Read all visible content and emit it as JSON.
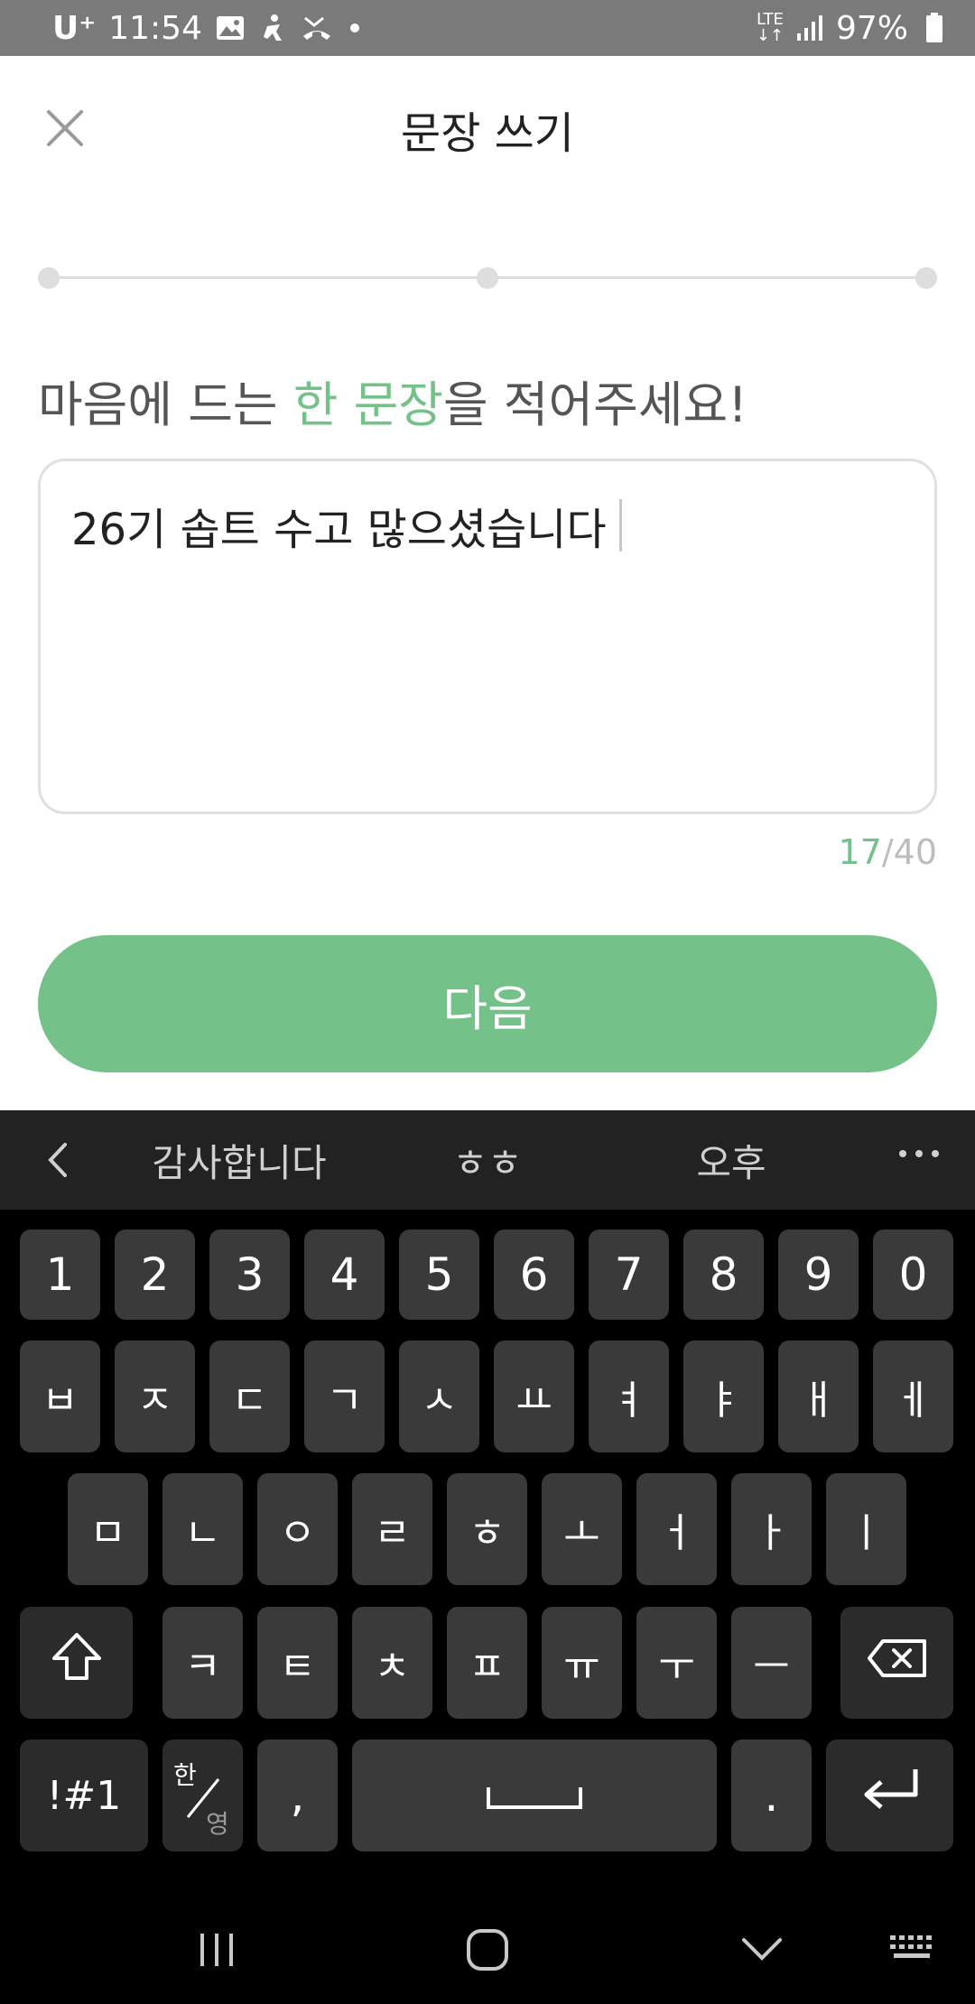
{
  "status_bar": {
    "carrier": "U⁺",
    "time": "11:54",
    "network": "LTE",
    "battery": "97%",
    "icons": [
      "image-icon",
      "accessibility-icon",
      "missed-call-icon",
      "dot-icon",
      "signal-icon",
      "battery-icon"
    ]
  },
  "header": {
    "title": "문장 쓰기",
    "close_icon": "close-icon"
  },
  "steps": {
    "count": 3,
    "current": 1
  },
  "prompt": {
    "before": "마음에 드는 ",
    "highlight": "한 문장",
    "after": "을 적어주세요!"
  },
  "input": {
    "value": "26기 솝트 수고 많으셨습니다",
    "count": "17",
    "max": "/40"
  },
  "next_button": {
    "label": "다음"
  },
  "keyboard": {
    "suggestions": [
      "감사합니다",
      "ㅎㅎ",
      "오후"
    ],
    "number_row": [
      "1",
      "2",
      "3",
      "4",
      "5",
      "6",
      "7",
      "8",
      "9",
      "0"
    ],
    "row1": [
      "ㅂ",
      "ㅈ",
      "ㄷ",
      "ㄱ",
      "ㅅ",
      "ㅛ",
      "ㅕ",
      "ㅑ",
      "ㅐ",
      "ㅔ"
    ],
    "row2": [
      "ㅁ",
      "ㄴ",
      "ㅇ",
      "ㄹ",
      "ㅎ",
      "ㅗ",
      "ㅓ",
      "ㅏ",
      "ㅣ"
    ],
    "row3": [
      "ㅋ",
      "ㅌ",
      "ㅊ",
      "ㅍ",
      "ㅠ",
      "ㅜ",
      "ㅡ"
    ],
    "symbols_label": "!#1",
    "lang_top": "한",
    "lang_bottom": "영",
    "comma": ",",
    "period": "."
  },
  "colors": {
    "accent": "#74c18a",
    "status_bar": "#7a7a7a",
    "keyboard_bg": "#000000",
    "key_bg": "#3a3a3a"
  }
}
